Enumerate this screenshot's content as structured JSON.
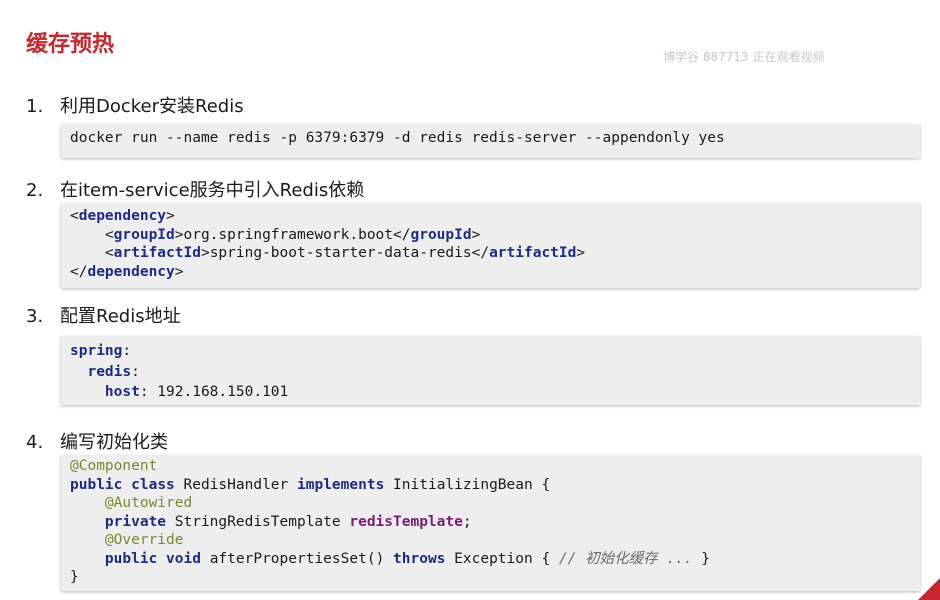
{
  "title": "缓存预热",
  "watermark": "博学谷 887713 正在观看视频",
  "steps": [
    {
      "num": "1.",
      "text": "利用Docker安装Redis"
    },
    {
      "num": "2.",
      "text": "在item-service服务中引入Redis依赖"
    },
    {
      "num": "3.",
      "text": "配置Redis地址"
    },
    {
      "num": "4.",
      "text": "编写初始化类"
    }
  ],
  "code1": {
    "line": "docker run --name redis -p 6379:6379 -d redis redis-server --appendonly yes"
  },
  "code2": {
    "open_lt": "<",
    "dependency": "dependency",
    "gt": ">",
    "groupId": "groupId",
    "group_value": "org.springframework.boot",
    "artifactId": "artifactId",
    "artifact_value": "spring-boot-starter-data-redis",
    "close_lt": "</"
  },
  "code3": {
    "spring": "spring",
    "redis": "redis",
    "host": "host",
    "colon": ":",
    "host_value": " 192.168.150.101"
  },
  "code4": {
    "component": "@Component",
    "public": "public",
    "class": "class",
    "class_name": " RedisHandler ",
    "implements": "implements",
    "interface": " InitializingBean {",
    "autowired": "@Autowired",
    "private": "private",
    "template_type": " StringRedisTemplate ",
    "field": "redisTemplate",
    "semicolon": ";",
    "override": "@Override",
    "void": "void",
    "method": " afterPropertiesSet() ",
    "throws": "throws",
    "exception": " Exception { ",
    "comment": "// 初始化缓存 ...",
    "end_brace_inline": " }",
    "close_brace": "}"
  }
}
